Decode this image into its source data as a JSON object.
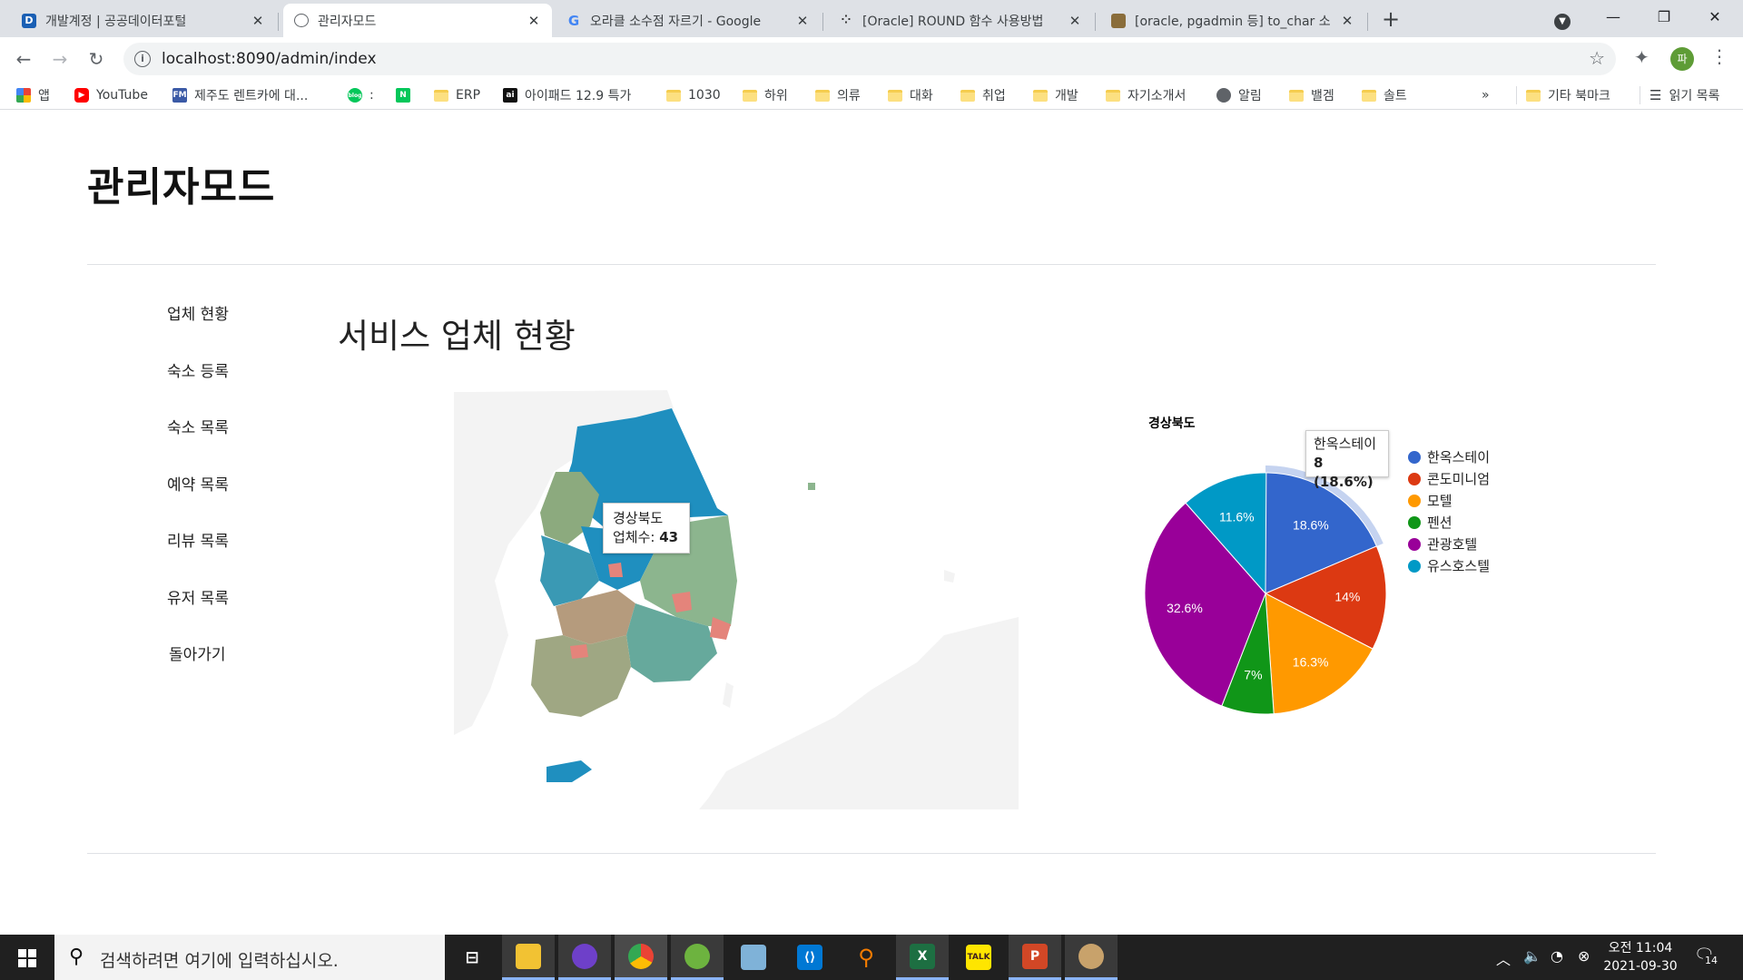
{
  "browser": {
    "tabs": [
      {
        "label": "개발계정 | 공공데이터포털",
        "favicon": "D",
        "color": "#1a5fb4"
      },
      {
        "label": "관리자모드",
        "favicon": "globe",
        "color": "#5f6368"
      },
      {
        "label": "오라클 소수점 자르기 - Google",
        "favicon": "G",
        "color": "#4285f4"
      },
      {
        "label": "[Oracle] ROUND 함수 사용방법",
        "favicon": "dots",
        "color": "#333333"
      },
      {
        "label": "[oracle, pgadmin 등] to_char 소",
        "favicon": "img",
        "color": "#8a6d3b"
      }
    ],
    "url": "localhost:8090/admin/index",
    "profile_initial": "파",
    "bookmarks": [
      {
        "label": "앱",
        "icon": "apps-icon"
      },
      {
        "label": "YouTube",
        "icon": "youtube-icon"
      },
      {
        "label": "제주도 렌트카에 대...",
        "icon": "fm-icon"
      },
      {
        "label": ":",
        "icon": "blog-icon"
      },
      {
        "label": "",
        "icon": "naver-icon"
      },
      {
        "label": "ERP",
        "icon": "folder-icon"
      },
      {
        "label": "아이패드 12.9 특가",
        "icon": "ai-icon"
      },
      {
        "label": "1030",
        "icon": "folder-icon"
      },
      {
        "label": "하위",
        "icon": "folder-icon"
      },
      {
        "label": "의류",
        "icon": "folder-icon"
      },
      {
        "label": "대화",
        "icon": "folder-icon"
      },
      {
        "label": "취업",
        "icon": "folder-icon"
      },
      {
        "label": "개발",
        "icon": "folder-icon"
      },
      {
        "label": "자기소개서",
        "icon": "folder-icon"
      },
      {
        "label": "알림",
        "icon": "globe-icon"
      },
      {
        "label": "밸겜",
        "icon": "folder-icon"
      },
      {
        "label": "솔트",
        "icon": "folder-icon"
      }
    ],
    "overflow": "»",
    "other_bookmarks": "기타 북마크",
    "reading_list": "읽기 목록"
  },
  "page": {
    "title": "관리자모드",
    "nav": [
      "업체 현황",
      "숙소 등록",
      "숙소 목록",
      "예약 목록",
      "리뷰 목록",
      "유저 목록",
      "돌아가기"
    ],
    "heading": "서비스 업체 현황",
    "map_tooltip": {
      "region": "경상북도",
      "label": "업체수:",
      "value": "43"
    }
  },
  "chart_data": {
    "type": "pie",
    "title": "경상북도",
    "slices": [
      {
        "name": "한옥스테이",
        "percent": 18.6,
        "label": "18.6%",
        "color": "#3366cc"
      },
      {
        "name": "콘도미니엄",
        "percent": 14.0,
        "label": "14%",
        "color": "#dc3912"
      },
      {
        "name": "모텔",
        "percent": 16.3,
        "label": "16.3%",
        "color": "#ff9900"
      },
      {
        "name": "펜션",
        "percent": 7.0,
        "label": "7%",
        "color": "#109618"
      },
      {
        "name": "관광호텔",
        "percent": 32.6,
        "label": "32.6%",
        "color": "#990099"
      },
      {
        "name": "유스호스텔",
        "percent": 11.6,
        "label": "11.6%",
        "color": "#0099c6"
      }
    ],
    "tooltip": {
      "name": "한옥스테이",
      "value": "8 (18.6%)"
    },
    "legend": "right"
  },
  "taskbar": {
    "search_placeholder": "검색하려면 여기에 입력하십시오.",
    "time": "오전 11:04",
    "date": "2021-09-30",
    "notifications": "14"
  }
}
